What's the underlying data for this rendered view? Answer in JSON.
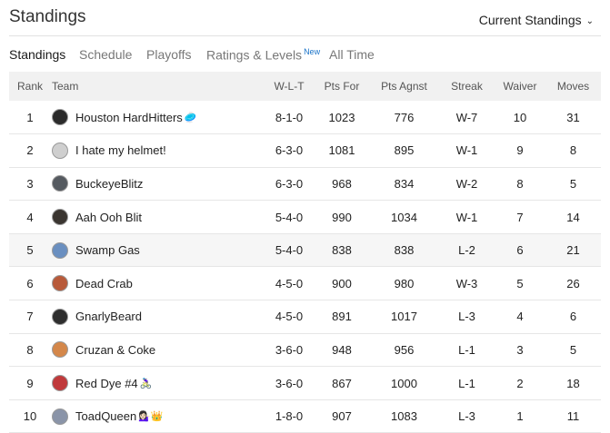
{
  "header": {
    "title": "Standings",
    "dropdown_label": "Current Standings"
  },
  "tabs": [
    {
      "label": "Standings",
      "active": true
    },
    {
      "label": "Schedule"
    },
    {
      "label": "Playoffs"
    },
    {
      "label": "Ratings & Levels",
      "badge": "New"
    },
    {
      "label": "All Time"
    }
  ],
  "table": {
    "columns": [
      "Rank",
      "Team",
      "W-L-T",
      "Pts For",
      "Pts Agnst",
      "Streak",
      "Waiver",
      "Moves"
    ],
    "rows": [
      {
        "rank": "1",
        "team": "Houston HardHitters",
        "emoji": "🥏",
        "wlt": "8-1-0",
        "pf": "1023",
        "pa": "776",
        "streak": "W-7",
        "waiver": "10",
        "moves": "31",
        "logo_color": "#2b2b2b"
      },
      {
        "rank": "2",
        "team": "I hate my helmet!",
        "emoji": "",
        "wlt": "6-3-0",
        "pf": "1081",
        "pa": "895",
        "streak": "W-1",
        "waiver": "9",
        "moves": "8",
        "logo_color": "#cfcfcf"
      },
      {
        "rank": "3",
        "team": "BuckeyeBlitz",
        "emoji": "",
        "wlt": "6-3-0",
        "pf": "968",
        "pa": "834",
        "streak": "W-2",
        "waiver": "8",
        "moves": "5",
        "logo_color": "#555a60"
      },
      {
        "rank": "4",
        "team": "Aah Ooh Blit",
        "emoji": "",
        "wlt": "5-4-0",
        "pf": "990",
        "pa": "1034",
        "streak": "W-1",
        "waiver": "7",
        "moves": "14",
        "logo_color": "#3a3530"
      },
      {
        "rank": "5",
        "team": "Swamp Gas",
        "emoji": "",
        "wlt": "5-4-0",
        "pf": "838",
        "pa": "838",
        "streak": "L-2",
        "waiver": "6",
        "moves": "21",
        "logo_color": "#6a8fc0",
        "highlight": true
      },
      {
        "rank": "6",
        "team": "Dead Crab",
        "emoji": "",
        "wlt": "4-5-0",
        "pf": "900",
        "pa": "980",
        "streak": "W-3",
        "waiver": "5",
        "moves": "26",
        "logo_color": "#b85a3a"
      },
      {
        "rank": "7",
        "team": "GnarlyBeard",
        "emoji": "",
        "wlt": "4-5-0",
        "pf": "891",
        "pa": "1017",
        "streak": "L-3",
        "waiver": "4",
        "moves": "6",
        "logo_color": "#2e2e2e"
      },
      {
        "rank": "8",
        "team": "Cruzan & Coke",
        "emoji": "",
        "wlt": "3-6-0",
        "pf": "948",
        "pa": "956",
        "streak": "L-1",
        "waiver": "3",
        "moves": "5",
        "logo_color": "#d4874a"
      },
      {
        "rank": "9",
        "team": "Red Dye #4",
        "emoji": "🚴🏻‍♀️",
        "wlt": "3-6-0",
        "pf": "867",
        "pa": "1000",
        "streak": "L-1",
        "waiver": "2",
        "moves": "18",
        "logo_color": "#c0393b"
      },
      {
        "rank": "10",
        "team": "ToadQueen",
        "emoji": "💁🏻‍♀️👑",
        "wlt": "1-8-0",
        "pf": "907",
        "pa": "1083",
        "streak": "L-3",
        "waiver": "1",
        "moves": "11",
        "logo_color": "#8a94a8"
      }
    ]
  }
}
